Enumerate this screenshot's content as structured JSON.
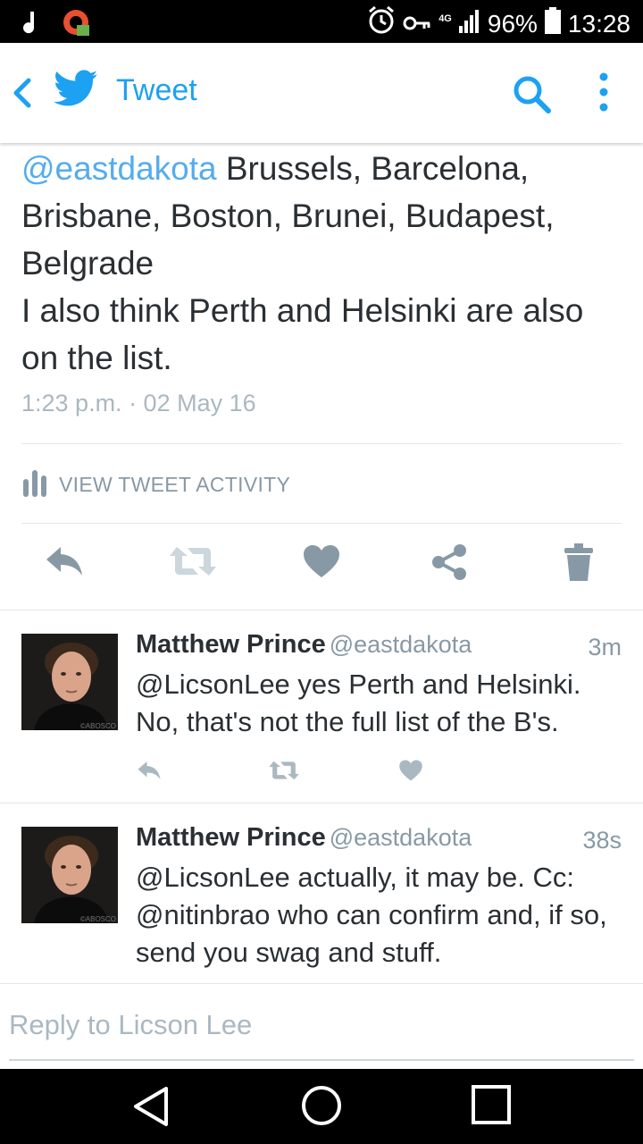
{
  "status_bar": {
    "battery": "96%",
    "time": "13:28",
    "network": "4G"
  },
  "app_bar": {
    "title": "Tweet"
  },
  "tweet": {
    "mention": "@eastdakota",
    "text_line1": " Brussels, Barcelona,",
    "text_line2": "Brisbane, Boston, Brunei, Budapest,",
    "text_line3": "Belgrade",
    "text_line4": "I also think Perth and Helsinki are also",
    "text_line5": "on the list.",
    "timestamp": "1:23 p.m. · 02 May 16",
    "activity_label": "VIEW TWEET ACTIVITY"
  },
  "replies": [
    {
      "name": "Matthew Prince",
      "handle": "@eastdakota",
      "time": "3m",
      "line1": "@LicsonLee yes Perth and Helsinki.",
      "line2": "No, that's not the full list of the B's.",
      "line3": ""
    },
    {
      "name": "Matthew Prince",
      "handle": "@eastdakota",
      "time": "38s",
      "line1": "@LicsonLee actually, it may be. Cc:",
      "line2": "@nitinbrao who can confirm and, if so,",
      "line3": "send you swag and stuff."
    }
  ],
  "avatar_watermark": "©ABOSCO",
  "compose": {
    "placeholder": "Reply to Licson Lee"
  },
  "colors": {
    "twitter_blue": "#1da1f2",
    "mention_blue": "#55acee",
    "icon_gray": "#8899a6",
    "text_dark": "#292f33"
  }
}
